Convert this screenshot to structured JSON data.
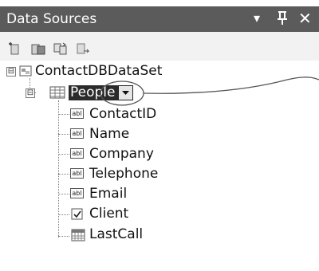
{
  "window": {
    "title": "Data Sources",
    "buttons": [
      {
        "name": "dropdown",
        "glyph": "▾"
      },
      {
        "name": "pin",
        "glyph": "⊥"
      },
      {
        "name": "close",
        "glyph": "✕"
      }
    ]
  },
  "toolbar": {
    "icons": [
      "add-new-data-source-icon",
      "edit-dataset-icon",
      "configure-dataset-icon",
      "refresh-icon"
    ]
  },
  "tree": {
    "root": {
      "label": "ContactDBDataSet",
      "expander": "⊟"
    },
    "table": {
      "label": "People",
      "expander": "⊟"
    },
    "fields": [
      {
        "label": "ContactID",
        "icon": "abl"
      },
      {
        "label": "Name",
        "icon": "abl"
      },
      {
        "label": "Company",
        "icon": "abl"
      },
      {
        "label": "Telephone",
        "icon": "abl"
      },
      {
        "label": "Email",
        "icon": "abl"
      },
      {
        "label": "Client",
        "icon": "checkbox"
      },
      {
        "label": "LastCall",
        "icon": "calendar"
      }
    ]
  },
  "colors": {
    "titlebar": "#5b5b5b",
    "selection": "#2b2b2b",
    "callout": "#555555"
  }
}
